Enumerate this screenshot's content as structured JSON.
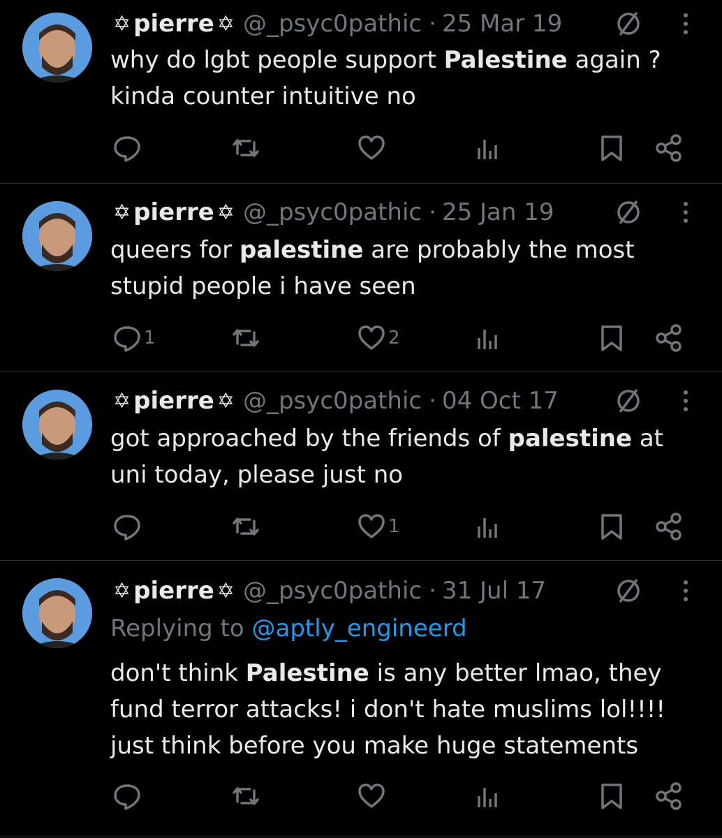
{
  "tweets": [
    {
      "name": "pierre",
      "star": "✡",
      "handle": "@_psyc0pathic",
      "separator": "·",
      "date": "25 Mar 19",
      "replying_to_label": "",
      "replying_to_handle": "",
      "text_parts": [
        "why do lgbt people support ",
        "Palestine",
        " again ?\nkinda counter intuitive no"
      ],
      "counts": {
        "reply": "",
        "repost": "",
        "like": ""
      }
    },
    {
      "name": "pierre",
      "star": "✡",
      "handle": "@_psyc0pathic",
      "separator": "·",
      "date": "25 Jan 19",
      "replying_to_label": "",
      "replying_to_handle": "",
      "text_parts": [
        "queers for ",
        "palestine",
        " are probably the most\nstupid people i have seen"
      ],
      "counts": {
        "reply": "1",
        "repost": "",
        "like": "2"
      }
    },
    {
      "name": "pierre",
      "star": "✡",
      "handle": "@_psyc0pathic",
      "separator": "·",
      "date": "04 Oct 17",
      "replying_to_label": "",
      "replying_to_handle": "",
      "text_parts": [
        "got approached by the friends of ",
        "palestine",
        " at\nuni today, please just no"
      ],
      "counts": {
        "reply": "",
        "repost": "",
        "like": "1"
      }
    },
    {
      "name": "pierre",
      "star": "✡",
      "handle": "@_psyc0pathic",
      "separator": "·",
      "date": "31 Jul 17",
      "replying_to_label": "Replying to ",
      "replying_to_handle": "@aptly_engineerd",
      "text_parts": [
        "don't think ",
        "Palestine",
        " is any better lmao, they\nfund terror attacks! i don't hate muslims lol!!!!\njust think before you make huge statements"
      ],
      "counts": {
        "reply": "",
        "repost": "",
        "like": ""
      }
    }
  ],
  "colors": {
    "background": "#000000",
    "text": "#e7e9ea",
    "muted": "#71767b",
    "link": "#1d9bf0",
    "divider": "#2f3336"
  },
  "icons": [
    "reply-icon",
    "repost-icon",
    "like-icon",
    "views-icon",
    "bookmark-icon",
    "share-icon",
    "grok-icon",
    "more-icon",
    "star-of-david-icon"
  ]
}
